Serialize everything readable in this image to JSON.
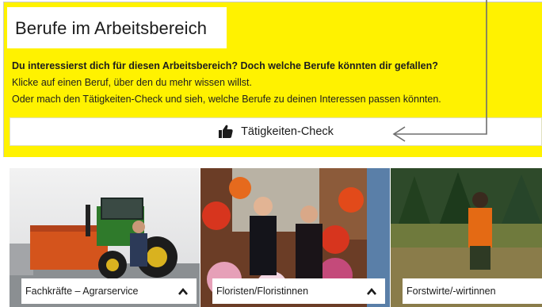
{
  "section": {
    "title": "Berufe im Arbeitsbereich",
    "question": "Du interessierst dich für diesen Arbeitsbereich? Doch welche Berufe könnten dir gefallen?",
    "line_click": "Klicke auf einen Beruf, über den du mehr wissen willst.",
    "line_check": "Oder mach den Tätigkeiten-Check und sieh, welche Berufe zu deinen Interessen passen könnten."
  },
  "check_button": {
    "label": "Tätigkeiten-Check",
    "icon": "thumbs-up-icon"
  },
  "careers": [
    {
      "label": "Fachkräfte – Agrarservice",
      "expanded": true,
      "icon": "chevron-up-icon"
    },
    {
      "label": "Floristen/Floristinnen",
      "expanded": true,
      "icon": "chevron-up-icon"
    },
    {
      "label": "Forstwirte/-wirtinnen",
      "expanded": false
    }
  ],
  "colors": {
    "accent": "#fff200",
    "text": "#1b1b1b"
  }
}
